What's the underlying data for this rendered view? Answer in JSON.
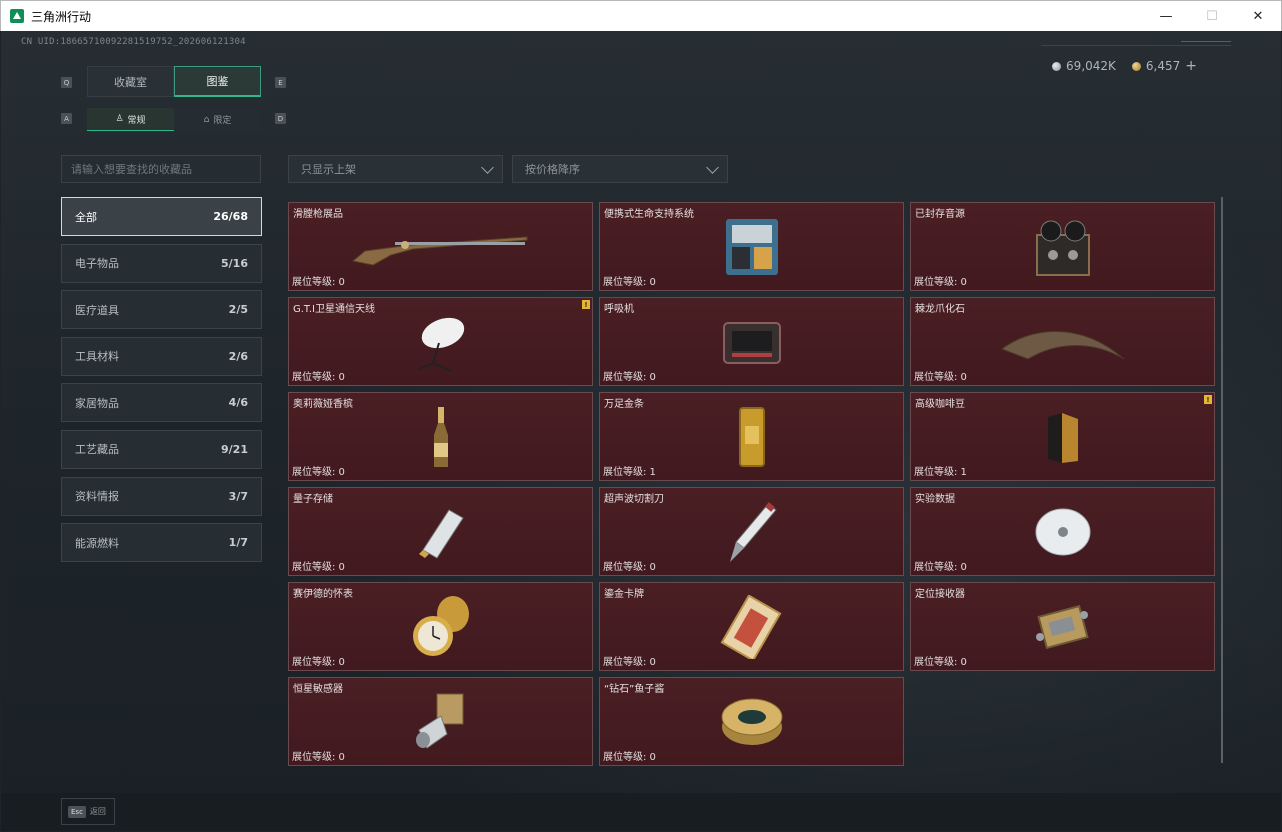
{
  "window": {
    "title": "三角洲行动",
    "controls": {
      "minimize": "—",
      "maximize": "☐",
      "close": "✕"
    }
  },
  "header": {
    "uid": "CN UID:18665710092281519752_202606121304",
    "currency": [
      {
        "icon": "silver-coin-icon",
        "value": "69,042K"
      },
      {
        "icon": "gold-coin-icon",
        "value": "6,457"
      }
    ],
    "add_label": "+"
  },
  "tabs": {
    "prev_key": "Q",
    "next_key": "E",
    "items": [
      {
        "label": "收藏室",
        "active": false
      },
      {
        "label": "图鉴",
        "active": true
      }
    ]
  },
  "subtabs": {
    "prev_key": "A",
    "next_key": "D",
    "items": [
      {
        "label": "常规",
        "active": true
      },
      {
        "label": "限定",
        "active": false
      }
    ]
  },
  "search": {
    "placeholder": "请输入想要查找的收藏品"
  },
  "filters": {
    "show": "只显示上架",
    "sort": "按价格降序"
  },
  "categories": [
    {
      "label": "全部",
      "count": "26/68",
      "active": true
    },
    {
      "label": "电子物品",
      "count": "5/16"
    },
    {
      "label": "医疗道具",
      "count": "2/5"
    },
    {
      "label": "工具材料",
      "count": "2/6"
    },
    {
      "label": "家居物品",
      "count": "4/6"
    },
    {
      "label": "工艺藏品",
      "count": "9/21"
    },
    {
      "label": "资料情报",
      "count": "3/7"
    },
    {
      "label": "能源燃料",
      "count": "1/7"
    }
  ],
  "items": [
    {
      "name": "滑膛枪展品",
      "level": "展位等级: 0",
      "art": "musket"
    },
    {
      "name": "便携式生命支持系统",
      "level": "展位等级: 0",
      "art": "life-support"
    },
    {
      "name": "已封存音源",
      "level": "展位等级: 0",
      "art": "reel-recorder"
    },
    {
      "name": "G.T.I卫星通信天线",
      "level": "展位等级: 0",
      "art": "satellite-dish",
      "badge": "!"
    },
    {
      "name": "呼吸机",
      "level": "展位等级: 0",
      "art": "ventilator"
    },
    {
      "name": "棘龙爪化石",
      "level": "展位等级: 0",
      "art": "claw-fossil"
    },
    {
      "name": "奥莉薇娅香槟",
      "level": "展位等级: 0",
      "art": "champagne"
    },
    {
      "name": "万足金条",
      "level": "展位等级: 1",
      "art": "gold-bar"
    },
    {
      "name": "高级咖啡豆",
      "level": "展位等级: 1",
      "art": "coffee-bag",
      "badge": "!"
    },
    {
      "name": "量子存储",
      "level": "展位等级: 0",
      "art": "quantum-drive"
    },
    {
      "name": "超声波切割刀",
      "level": "展位等级: 0",
      "art": "ultrasonic-knife"
    },
    {
      "name": "实验数据",
      "level": "展位等级: 0",
      "art": "disc"
    },
    {
      "name": "赛伊德的怀表",
      "level": "展位等级: 0",
      "art": "pocket-watch"
    },
    {
      "name": "鎏金卡牌",
      "level": "展位等级: 0",
      "art": "gilded-card"
    },
    {
      "name": "定位接收器",
      "level": "展位等级: 0",
      "art": "locator"
    },
    {
      "name": "恒星敏感器",
      "level": "展位等级: 0",
      "art": "star-sensor"
    },
    {
      "name": "“钻石”鱼子酱",
      "level": "展位等级: 0",
      "art": "caviar-tin"
    }
  ],
  "footer": {
    "esc_key": "Esc",
    "back_label": "返回"
  },
  "colors": {
    "accent": "#2fb88c",
    "card_bg": "#4a1f24",
    "card_border": "#6a4a4e",
    "badge": "#e3b637"
  }
}
